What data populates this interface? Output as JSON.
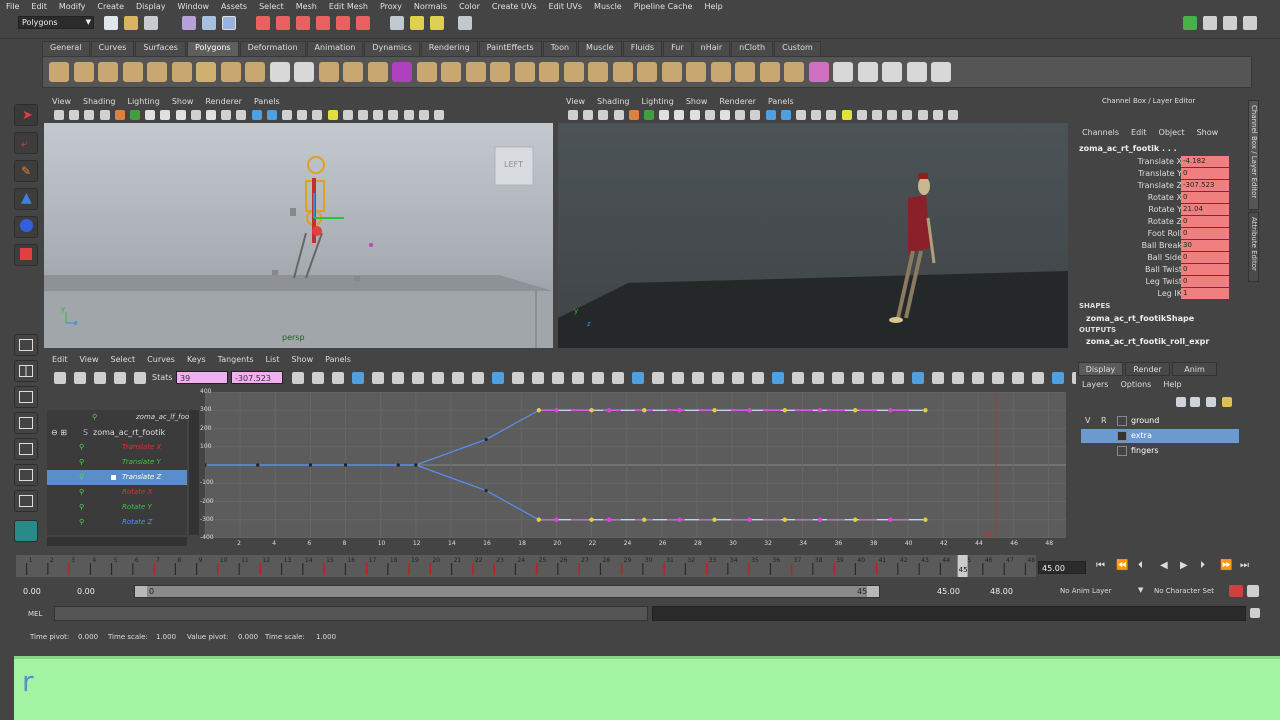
{
  "menubar": [
    "File",
    "Edit",
    "Modify",
    "Create",
    "Display",
    "Window",
    "Assets",
    "Select",
    "Mesh",
    "Edit Mesh",
    "Proxy",
    "Normals",
    "Color",
    "Create UVs",
    "Edit UVs",
    "Muscle",
    "Pipeline Cache",
    "Help"
  ],
  "mode_selector": "Polygons",
  "shelf_tabs": [
    "General",
    "Curves",
    "Surfaces",
    "Polygons",
    "Deformation",
    "Animation",
    "Dynamics",
    "Rendering",
    "PaintEffects",
    "Toon",
    "Muscle",
    "Fluids",
    "Fur",
    "nHair",
    "nCloth",
    "Custom"
  ],
  "active_shelf_tab": "Polygons",
  "viewport_menu": [
    "View",
    "Shading",
    "Lighting",
    "Show",
    "Renderer",
    "Panels"
  ],
  "viewport_left": {
    "camera_label": "persp",
    "viewcube_label": "LEFT",
    "axis_y": "y",
    "axis_z": "z"
  },
  "viewport_right": {
    "axis_y": "y",
    "axis_z": "z"
  },
  "graph_editor": {
    "menu": [
      "Edit",
      "View",
      "Select",
      "Curves",
      "Keys",
      "Tangents",
      "List",
      "Show",
      "Panels"
    ],
    "stats_label": "Stats",
    "stats_key": "39",
    "stats_value": "-307.523",
    "outliner_top": "zoma_ac_lf_foot",
    "outliner_node": "zoma_ac_rt_footik",
    "channels": [
      "Translate X",
      "Translate Y",
      "Translate Z",
      "Rotate X",
      "Rotate Y",
      "Rotate Z"
    ],
    "channel_colors": [
      "#e03030",
      "#40c040",
      "#5a8ef0",
      "#e03030",
      "#40c040",
      "#5a8ef0"
    ],
    "selected_channel": "Translate Z",
    "y_ticks": [
      "400",
      "300",
      "200",
      "100",
      "",
      "-100",
      "-200",
      "-300",
      "-400"
    ],
    "x_ticks": [
      "2",
      "4",
      "6",
      "8",
      "10",
      "12",
      "14",
      "16",
      "18",
      "20",
      "22",
      "24",
      "26",
      "28",
      "30",
      "32",
      "34",
      "36",
      "38",
      "40",
      "42",
      "44",
      "46",
      "48"
    ],
    "current_frame_label": "45"
  },
  "chart_data": {
    "type": "line",
    "title": "",
    "xlabel": "",
    "ylabel": "",
    "xlim": [
      0,
      49
    ],
    "ylim": [
      -400,
      400
    ],
    "current_frame": 45,
    "series": [
      {
        "name": "Translate Z (upper)",
        "color": "#5a8ef0",
        "x": [
          0,
          3,
          6,
          8,
          11,
          12,
          16,
          19,
          20,
          22,
          23,
          25,
          27,
          29,
          31,
          33,
          35,
          37,
          39,
          41
        ],
        "y": [
          0,
          0,
          0,
          0,
          0,
          0,
          140,
          300,
          300,
          300,
          300,
          300,
          300,
          300,
          300,
          300,
          300,
          300,
          300,
          300
        ]
      },
      {
        "name": "Translate Z (lower)",
        "color": "#5a8ef0",
        "x": [
          0,
          3,
          6,
          8,
          11,
          12,
          16,
          19,
          20,
          22,
          23,
          25,
          27,
          29,
          31,
          33,
          35,
          37,
          39,
          41
        ],
        "y": [
          0,
          0,
          0,
          0,
          0,
          0,
          -140,
          -300,
          -300,
          -300,
          -300,
          -300,
          -300,
          -300,
          -300,
          -300,
          -300,
          -300,
          -300,
          -300
        ]
      }
    ],
    "grid": true
  },
  "channel_box": {
    "header": "Channel Box / Layer Editor",
    "menu": [
      "Channels",
      "Edit",
      "Object",
      "Show"
    ],
    "object_name": "zoma_ac_rt_footik . . .",
    "attributes": [
      {
        "label": "Translate X",
        "value": "-4.182"
      },
      {
        "label": "Translate Y",
        "value": "0"
      },
      {
        "label": "Translate Z",
        "value": "-307.523"
      },
      {
        "label": "Rotate X",
        "value": "0"
      },
      {
        "label": "Rotate Y",
        "value": "21.04"
      },
      {
        "label": "Rotate Z",
        "value": "0"
      },
      {
        "label": "Foot Roll",
        "value": "0"
      },
      {
        "label": "Ball Break",
        "value": "30"
      },
      {
        "label": "Ball Side",
        "value": "0"
      },
      {
        "label": "Ball Twist",
        "value": "0"
      },
      {
        "label": "Leg Twist",
        "value": "0"
      },
      {
        "label": "Leg IK",
        "value": "1"
      }
    ],
    "shapes_label": "SHAPES",
    "shape_name": "zoma_ac_rt_footikShape",
    "outputs_label": "OUTPUTS",
    "output_name": "zoma_ac_rt_footik_roll_expr",
    "side_tab_1": "Channel Box / Layer Editor",
    "side_tab_2": "Attribute Editor"
  },
  "layer_editor": {
    "tabs": [
      "Display",
      "Render",
      "Anim"
    ],
    "menu": [
      "Layers",
      "Options",
      "Help"
    ],
    "layers": [
      {
        "v": "V",
        "r": "R",
        "name": "ground",
        "selected": false
      },
      {
        "v": "",
        "r": "",
        "name": "extra",
        "selected": true
      },
      {
        "v": "",
        "r": "",
        "name": "fingers",
        "selected": false
      }
    ]
  },
  "time_slider": {
    "ticks": [
      "1",
      "2",
      "3",
      "4",
      "5",
      "6",
      "7",
      "8",
      "9",
      "10",
      "11",
      "12",
      "13",
      "14",
      "15",
      "16",
      "17",
      "18",
      "19",
      "20",
      "21",
      "22",
      "23",
      "24",
      "25",
      "26",
      "27",
      "28",
      "29",
      "30",
      "31",
      "32",
      "33",
      "34",
      "35",
      "36",
      "37",
      "38",
      "39",
      "40",
      "41",
      "42",
      "43",
      "44",
      "45",
      "46",
      "47",
      "48"
    ],
    "current": "45",
    "current_field": "45.00"
  },
  "range": {
    "start": "0.00",
    "inner_start": "0.00",
    "slider_start": "0",
    "slider_end": "45",
    "inner_end": "45.00",
    "end": "48.00",
    "anim_layer": "No Anim Layer",
    "character_set": "No Character Set"
  },
  "command_line": {
    "label": "MEL"
  },
  "help_line": {
    "time_pivot_label": "Time pivot:",
    "time_pivot": "0.000",
    "time_scale_label": "Time scale:",
    "time_scale": "1.000",
    "value_pivot_label": "Value pivot:",
    "value_pivot": "0.000",
    "value_scale": "1.000"
  },
  "bottom_overlay": {
    "text": "r"
  }
}
